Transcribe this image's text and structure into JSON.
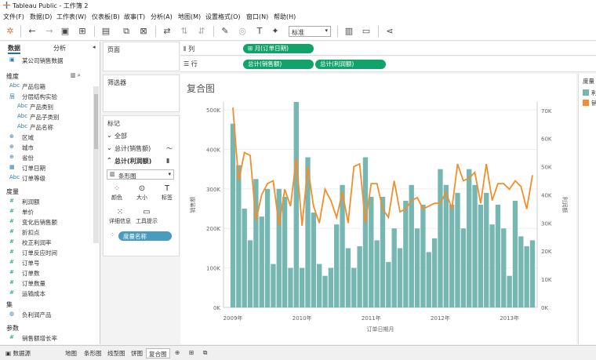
{
  "window": {
    "title": "Tableau Public - 工作簿 2"
  },
  "menu": [
    "文件(F)",
    "数据(D)",
    "工作表(W)",
    "仪表板(B)",
    "故事(T)",
    "分析(A)",
    "地图(M)",
    "设置格式(O)",
    "窗口(N)",
    "帮助(H)"
  ],
  "toolbar": {
    "fit_value": "标准"
  },
  "data_pane": {
    "tab_data": "数据",
    "tab_analysis": "分析",
    "datasource": "某公司销售数据",
    "dimensions_header": "维度",
    "dimensions": [
      {
        "icon": "Abc",
        "label": "产品包箱"
      },
      {
        "icon": "层",
        "label": "分层结构实验"
      },
      {
        "icon": "Abc",
        "label": "产品类别"
      },
      {
        "icon": "Abc",
        "label": "产品子类别"
      },
      {
        "icon": "Abc",
        "label": "产品名称"
      },
      {
        "icon": "⊕",
        "label": "区域"
      },
      {
        "icon": "⊕",
        "label": "城市"
      },
      {
        "icon": "⊕",
        "label": "省份"
      },
      {
        "icon": "▦",
        "label": "订单日期"
      },
      {
        "icon": "Abc",
        "label": "订单等级"
      }
    ],
    "measures_header": "度量",
    "measures": [
      "利润额",
      "单价",
      "变化后销售额",
      "折扣点",
      "校正利润率",
      "订单反应时间",
      "订单号",
      "订单数",
      "订单数量",
      "运输成本"
    ],
    "sets_header": "集",
    "sets": [
      "负利润产品"
    ],
    "params_header": "参数",
    "params": [
      "销售额增长率"
    ]
  },
  "shelves": {
    "pages_title": "页面",
    "filters_title": "筛选器",
    "marks_title": "标记",
    "marks_all": "全部",
    "marks_sales": "总计(销售额)",
    "marks_profit": "总计(利润额)",
    "mark_type": "条形图",
    "btn_color": "颜色",
    "btn_size": "大小",
    "btn_label": "标签",
    "btn_detail": "详细信息",
    "btn_tooltip": "工具提示",
    "measure_names_pill": "度量名称",
    "columns_label": "列",
    "rows_label": "行",
    "columns_pill": "月(订单日期)",
    "rows_pill_1": "总计(销售额)",
    "rows_pill_2": "总计(利润额)"
  },
  "sheet": {
    "title": "复合图",
    "legend_title": "度量",
    "legend_items": [
      "利",
      "销"
    ]
  },
  "bottom": {
    "datasource_tab": "数据源",
    "tabs": [
      "地图",
      "条形图",
      "线型图",
      "饼图",
      "复合图"
    ],
    "active": "复合图"
  },
  "colors": {
    "bar": "#76b7b2",
    "line": "#f28e2b",
    "pill_green": "#12a36a",
    "pill_blue": "#4a9cbf"
  },
  "chart_data": {
    "type": "bar",
    "title": "复合图",
    "xlabel": "订单日期月",
    "ylabel_left": "销售额",
    "ylabel_right": "利润额",
    "x_ticks": [
      "2009年",
      "2010年",
      "2011年",
      "2012年",
      "2013年"
    ],
    "y_ticks_left": [
      "0K",
      "100K",
      "200K",
      "300K",
      "400K",
      "500K"
    ],
    "y_ticks_right": [
      "0K",
      "10K",
      "20K",
      "30K",
      "40K",
      "50K",
      "60K",
      "70K"
    ],
    "ylim_left": [
      0,
      520000
    ],
    "ylim_right": [
      0,
      73000
    ],
    "grid": true,
    "series": [
      {
        "name": "销售额",
        "mark": "bar",
        "axis": "left",
        "values": [
          465000,
          360000,
          250000,
          170000,
          325000,
          230000,
          300000,
          110000,
          300000,
          280000,
          100000,
          520000,
          100000,
          380000,
          240000,
          110000,
          80000,
          100000,
          210000,
          310000,
          150000,
          100000,
          155000,
          380000,
          280000,
          170000,
          280000,
          115000,
          200000,
          150000,
          270000,
          310000,
          200000,
          260000,
          140000,
          175000,
          350000,
          310000,
          260000,
          290000,
          200000,
          350000,
          310000,
          260000,
          290000,
          210000,
          260000,
          200000,
          80000,
          270000,
          180000,
          155000,
          170000
        ]
      },
      {
        "name": "利润额",
        "mark": "line",
        "axis": "right",
        "values": [
          71000,
          45000,
          55000,
          54000,
          31000,
          40000,
          44000,
          45000,
          29000,
          42000,
          36000,
          53000,
          29000,
          50000,
          36000,
          30000,
          42000,
          38000,
          32000,
          41000,
          30000,
          50000,
          51000,
          30000,
          44000,
          44000,
          35000,
          32000,
          45000,
          34000,
          35000,
          38000,
          39000,
          35000,
          36000,
          37000,
          37000,
          41000,
          35000,
          51000,
          45000,
          46000,
          48000,
          37000,
          51000,
          38000,
          44000,
          44000,
          42000,
          45000,
          43000,
          35000,
          47000
        ]
      }
    ]
  }
}
